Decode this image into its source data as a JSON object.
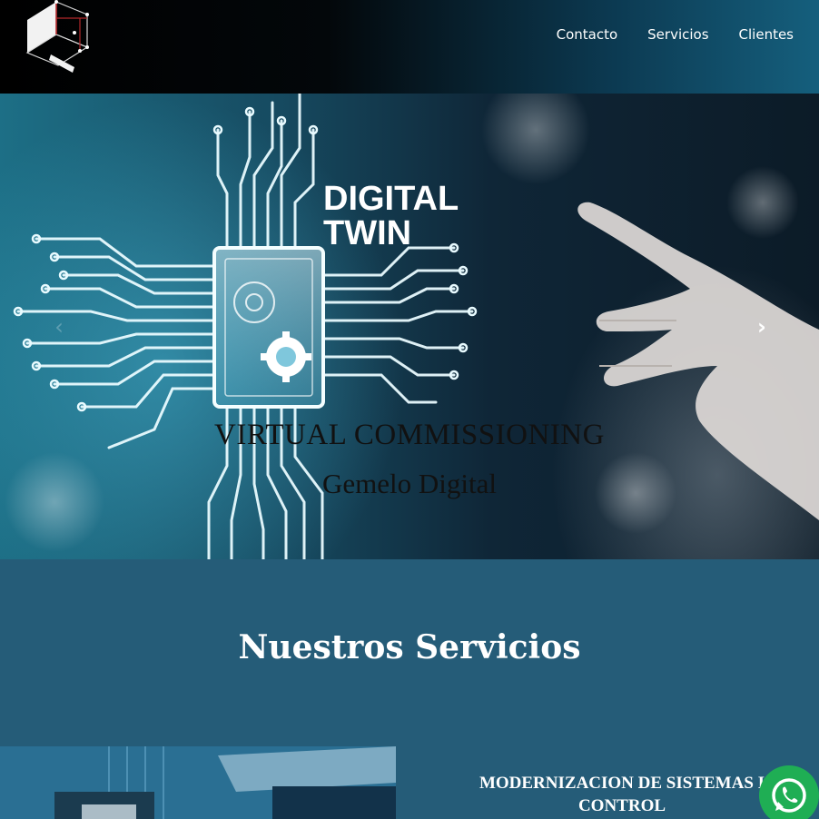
{
  "header": {
    "logo_icon": "cube-logo-icon",
    "nav": [
      {
        "label": "Contacto"
      },
      {
        "label": "Servicios"
      },
      {
        "label": "Clientes"
      }
    ]
  },
  "hero": {
    "title": "VIRTUAL COMMISSIONING",
    "subtitle": "Gemelo Digital",
    "image_text": "DIGITAL\nTWIN",
    "image_text_line1": "DIGITAL",
    "image_text_line2": "TWIN",
    "next_icon": "chevron-right-icon",
    "prev_icon": "chevron-left-icon"
  },
  "services": {
    "title": "Nuestros Servicios",
    "items": [
      {
        "title": "MODERNIZACION DE SISTEMAS DE CONTROL",
        "title_visible": "MODERNIZACION DE SISTEMAS I\nCONTROL"
      }
    ]
  },
  "floating": {
    "whatsapp_icon": "whatsapp-icon"
  },
  "colors": {
    "page_background": "#255c78",
    "header_dark": "#000000",
    "header_accent": "#155f7d",
    "whatsapp_green": "#1fae54"
  }
}
